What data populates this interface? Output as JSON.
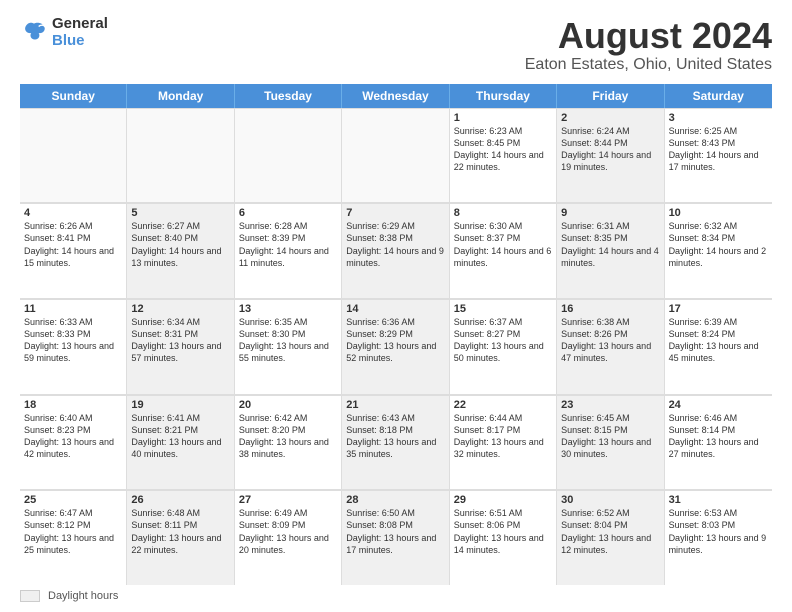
{
  "header": {
    "logo_general": "General",
    "logo_blue": "Blue",
    "title": "August 2024",
    "subtitle": "Eaton Estates, Ohio, United States"
  },
  "days_of_week": [
    "Sunday",
    "Monday",
    "Tuesday",
    "Wednesday",
    "Thursday",
    "Friday",
    "Saturday"
  ],
  "weeks": [
    [
      {
        "day": "",
        "text": "",
        "empty": true
      },
      {
        "day": "",
        "text": "",
        "empty": true
      },
      {
        "day": "",
        "text": "",
        "empty": true
      },
      {
        "day": "",
        "text": "",
        "empty": true
      },
      {
        "day": "1",
        "text": "Sunrise: 6:23 AM\nSunset: 8:45 PM\nDaylight: 14 hours and 22 minutes.",
        "shaded": false
      },
      {
        "day": "2",
        "text": "Sunrise: 6:24 AM\nSunset: 8:44 PM\nDaylight: 14 hours and 19 minutes.",
        "shaded": true
      },
      {
        "day": "3",
        "text": "Sunrise: 6:25 AM\nSunset: 8:43 PM\nDaylight: 14 hours and 17 minutes.",
        "shaded": false
      }
    ],
    [
      {
        "day": "4",
        "text": "Sunrise: 6:26 AM\nSunset: 8:41 PM\nDaylight: 14 hours and 15 minutes.",
        "shaded": false
      },
      {
        "day": "5",
        "text": "Sunrise: 6:27 AM\nSunset: 8:40 PM\nDaylight: 14 hours and 13 minutes.",
        "shaded": true
      },
      {
        "day": "6",
        "text": "Sunrise: 6:28 AM\nSunset: 8:39 PM\nDaylight: 14 hours and 11 minutes.",
        "shaded": false
      },
      {
        "day": "7",
        "text": "Sunrise: 6:29 AM\nSunset: 8:38 PM\nDaylight: 14 hours and 9 minutes.",
        "shaded": true
      },
      {
        "day": "8",
        "text": "Sunrise: 6:30 AM\nSunset: 8:37 PM\nDaylight: 14 hours and 6 minutes.",
        "shaded": false
      },
      {
        "day": "9",
        "text": "Sunrise: 6:31 AM\nSunset: 8:35 PM\nDaylight: 14 hours and 4 minutes.",
        "shaded": true
      },
      {
        "day": "10",
        "text": "Sunrise: 6:32 AM\nSunset: 8:34 PM\nDaylight: 14 hours and 2 minutes.",
        "shaded": false
      }
    ],
    [
      {
        "day": "11",
        "text": "Sunrise: 6:33 AM\nSunset: 8:33 PM\nDaylight: 13 hours and 59 minutes.",
        "shaded": false
      },
      {
        "day": "12",
        "text": "Sunrise: 6:34 AM\nSunset: 8:31 PM\nDaylight: 13 hours and 57 minutes.",
        "shaded": true
      },
      {
        "day": "13",
        "text": "Sunrise: 6:35 AM\nSunset: 8:30 PM\nDaylight: 13 hours and 55 minutes.",
        "shaded": false
      },
      {
        "day": "14",
        "text": "Sunrise: 6:36 AM\nSunset: 8:29 PM\nDaylight: 13 hours and 52 minutes.",
        "shaded": true
      },
      {
        "day": "15",
        "text": "Sunrise: 6:37 AM\nSunset: 8:27 PM\nDaylight: 13 hours and 50 minutes.",
        "shaded": false
      },
      {
        "day": "16",
        "text": "Sunrise: 6:38 AM\nSunset: 8:26 PM\nDaylight: 13 hours and 47 minutes.",
        "shaded": true
      },
      {
        "day": "17",
        "text": "Sunrise: 6:39 AM\nSunset: 8:24 PM\nDaylight: 13 hours and 45 minutes.",
        "shaded": false
      }
    ],
    [
      {
        "day": "18",
        "text": "Sunrise: 6:40 AM\nSunset: 8:23 PM\nDaylight: 13 hours and 42 minutes.",
        "shaded": false
      },
      {
        "day": "19",
        "text": "Sunrise: 6:41 AM\nSunset: 8:21 PM\nDaylight: 13 hours and 40 minutes.",
        "shaded": true
      },
      {
        "day": "20",
        "text": "Sunrise: 6:42 AM\nSunset: 8:20 PM\nDaylight: 13 hours and 38 minutes.",
        "shaded": false
      },
      {
        "day": "21",
        "text": "Sunrise: 6:43 AM\nSunset: 8:18 PM\nDaylight: 13 hours and 35 minutes.",
        "shaded": true
      },
      {
        "day": "22",
        "text": "Sunrise: 6:44 AM\nSunset: 8:17 PM\nDaylight: 13 hours and 32 minutes.",
        "shaded": false
      },
      {
        "day": "23",
        "text": "Sunrise: 6:45 AM\nSunset: 8:15 PM\nDaylight: 13 hours and 30 minutes.",
        "shaded": true
      },
      {
        "day": "24",
        "text": "Sunrise: 6:46 AM\nSunset: 8:14 PM\nDaylight: 13 hours and 27 minutes.",
        "shaded": false
      }
    ],
    [
      {
        "day": "25",
        "text": "Sunrise: 6:47 AM\nSunset: 8:12 PM\nDaylight: 13 hours and 25 minutes.",
        "shaded": false
      },
      {
        "day": "26",
        "text": "Sunrise: 6:48 AM\nSunset: 8:11 PM\nDaylight: 13 hours and 22 minutes.",
        "shaded": true
      },
      {
        "day": "27",
        "text": "Sunrise: 6:49 AM\nSunset: 8:09 PM\nDaylight: 13 hours and 20 minutes.",
        "shaded": false
      },
      {
        "day": "28",
        "text": "Sunrise: 6:50 AM\nSunset: 8:08 PM\nDaylight: 13 hours and 17 minutes.",
        "shaded": true
      },
      {
        "day": "29",
        "text": "Sunrise: 6:51 AM\nSunset: 8:06 PM\nDaylight: 13 hours and 14 minutes.",
        "shaded": false
      },
      {
        "day": "30",
        "text": "Sunrise: 6:52 AM\nSunset: 8:04 PM\nDaylight: 13 hours and 12 minutes.",
        "shaded": true
      },
      {
        "day": "31",
        "text": "Sunrise: 6:53 AM\nSunset: 8:03 PM\nDaylight: 13 hours and 9 minutes.",
        "shaded": false
      }
    ]
  ],
  "footer": {
    "legend_label": "Daylight hours"
  }
}
